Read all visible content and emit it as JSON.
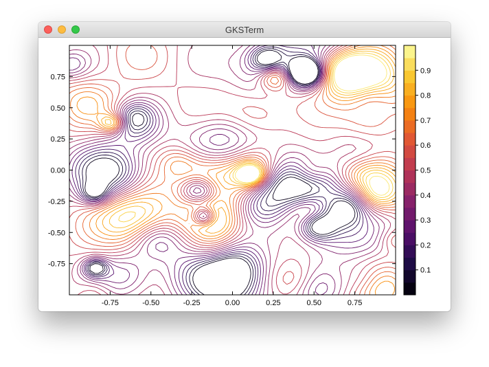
{
  "window": {
    "title": "GKSTerm"
  },
  "icons": {
    "close": "close-traffic-light",
    "minimize": "minimize-traffic-light",
    "maximize": "zoom-traffic-light"
  },
  "chart_data": {
    "type": "contour",
    "title": "",
    "xlabel": "",
    "ylabel": "",
    "xlim": [
      -1,
      1
    ],
    "ylim": [
      -1,
      1
    ],
    "x_ticks": [
      "-0.75",
      "-0.50",
      "-0.25",
      "0.00",
      "0.25",
      "0.50",
      "0.75"
    ],
    "y_ticks": [
      "0.75",
      "0.50",
      "0.25",
      "0.00",
      "-0.25",
      "-0.50",
      "-0.75"
    ],
    "x_tick_values": [
      -0.75,
      -0.5,
      -0.25,
      0.0,
      0.25,
      0.5,
      0.75
    ],
    "y_tick_values": [
      0.75,
      0.5,
      0.25,
      0.0,
      -0.25,
      -0.5,
      -0.75
    ],
    "colorbar": {
      "range": [
        0,
        1
      ],
      "ticks": [
        "0.1",
        "0.2",
        "0.3",
        "0.4",
        "0.5",
        "0.6",
        "0.7",
        "0.8",
        "0.9"
      ],
      "tick_values": [
        0.1,
        0.2,
        0.3,
        0.4,
        0.5,
        0.6,
        0.7,
        0.8,
        0.9
      ],
      "colormap": "inferno",
      "levels": 20
    },
    "grid": false,
    "legend": "colorbar-right"
  }
}
